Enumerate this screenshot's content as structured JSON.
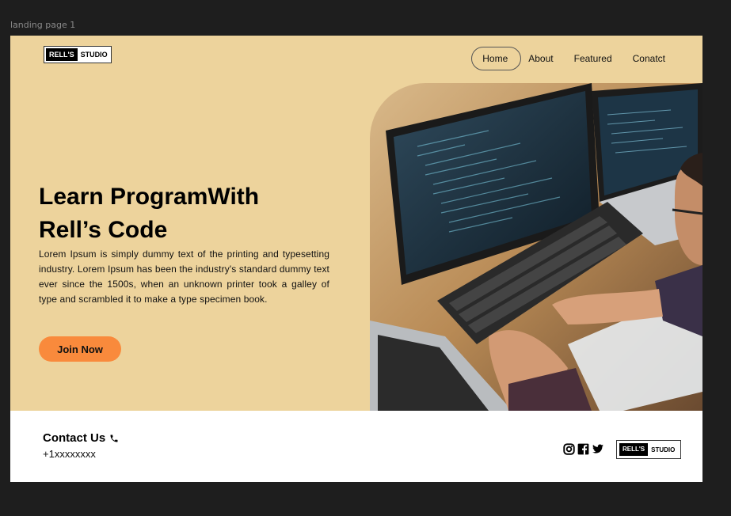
{
  "canvas": {
    "frame_label": "landing page 1"
  },
  "header": {
    "logo": {
      "dark": "RELL'S",
      "light": "STUDIO"
    },
    "nav": [
      {
        "label": "Home",
        "active": true
      },
      {
        "label": "About"
      },
      {
        "label": "Featured"
      },
      {
        "label": "Conatct"
      }
    ]
  },
  "hero": {
    "title_line1": "Learn ProgramWith",
    "title_line2": "Rell’s Code",
    "description": "Lorem Ipsum is simply dummy text of the printing and typesetting industry. Lorem Ipsum has been the industry's standard dummy text ever since the 1500s, when an unknown printer took a galley of type and scrambled it to make a type specimen book.",
    "cta_label": "Join Now",
    "image": "programmer-at-computer-photo"
  },
  "footer": {
    "contact_title": "Contact Us",
    "phone": "+1xxxxxxxx",
    "socials": [
      "instagram-icon",
      "facebook-icon",
      "twitter-icon"
    ],
    "logo": {
      "dark": "RELL'S",
      "light": "STUDIO"
    }
  },
  "colors": {
    "background": "#edd39c",
    "accent": "#f98a3c",
    "canvas": "#1e1e1e",
    "footer": "#ffffff"
  }
}
